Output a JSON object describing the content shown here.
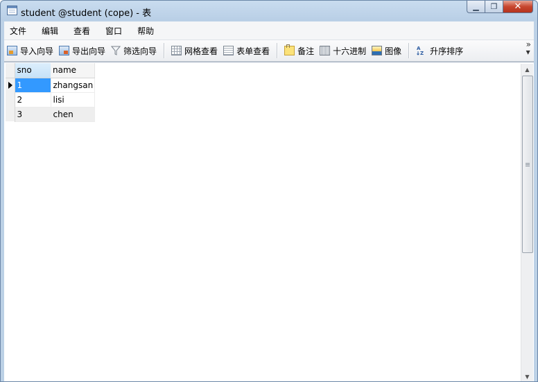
{
  "window": {
    "title": "student @student (cope) - 表",
    "controls": {
      "minimize": "▁",
      "maximize": "❐",
      "close": "✕"
    }
  },
  "menu": [
    "文件",
    "编辑",
    "查看",
    "窗口",
    "帮助"
  ],
  "toolbar": {
    "items": [
      {
        "label": "导入向导",
        "icon": "import-wizard-icon"
      },
      {
        "label": "导出向导",
        "icon": "export-wizard-icon"
      },
      {
        "label": "筛选向导",
        "icon": "filter-icon"
      },
      {
        "label": "网格查看",
        "icon": "grid-view-icon"
      },
      {
        "label": "表单查看",
        "icon": "form-view-icon"
      },
      {
        "label": "备注",
        "icon": "memo-icon"
      },
      {
        "label": "十六进制",
        "icon": "hex-icon"
      },
      {
        "label": "图像",
        "icon": "image-icon"
      },
      {
        "label": "升序排序",
        "icon": "sort-ascending-icon"
      }
    ],
    "overflow": "»"
  },
  "table": {
    "columns": [
      "sno",
      "name"
    ],
    "rows": [
      {
        "sno": "1",
        "name": "zhangsan"
      },
      {
        "sno": "2",
        "name": "lisi"
      },
      {
        "sno": "3",
        "name": "chen"
      }
    ],
    "selected_row": 0
  },
  "colors": {
    "selection": "#3399ff",
    "header_selected": "#c6e2f8",
    "titlebar": "#c9dcef"
  }
}
